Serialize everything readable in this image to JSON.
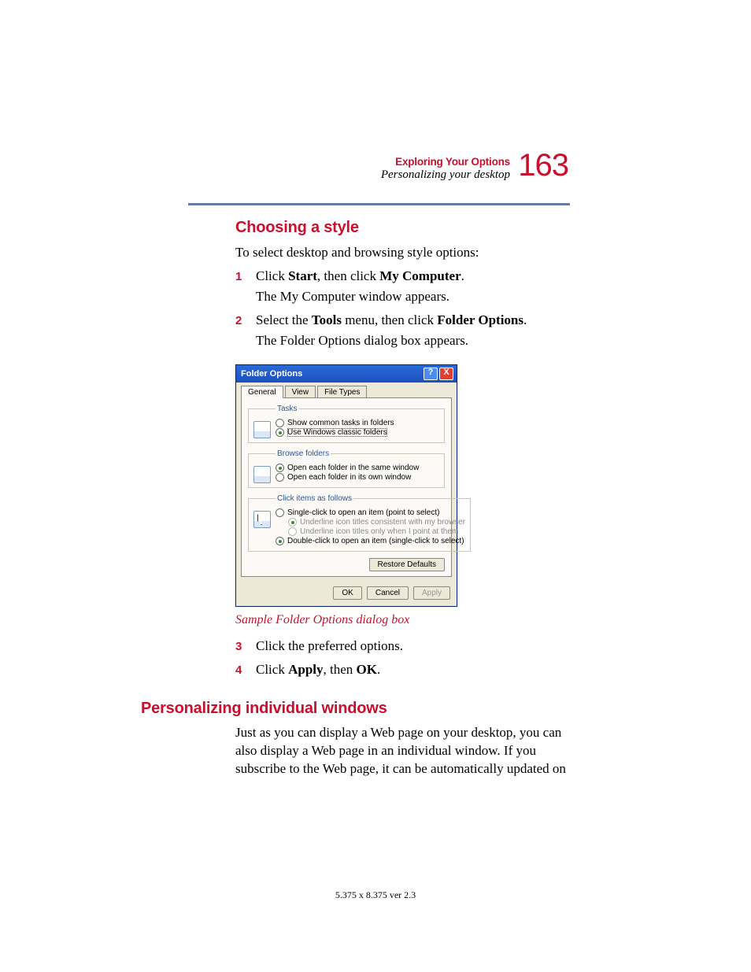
{
  "header": {
    "chapter": "Exploring Your Options",
    "section": "Personalizing your desktop",
    "page_number": "163"
  },
  "section1": {
    "heading": "Choosing a style",
    "intro": "To select desktop and browsing style options:"
  },
  "steps": {
    "s1": {
      "num": "1",
      "p1_a": "Click ",
      "p1_b": "Start",
      "p1_c": ", then click ",
      "p1_d": "My Computer",
      "p1_e": ".",
      "p2": "The My Computer window appears."
    },
    "s2": {
      "num": "2",
      "p1_a": "Select the ",
      "p1_b": "Tools",
      "p1_c": " menu, then click ",
      "p1_d": "Folder Options",
      "p1_e": ".",
      "p2": "The Folder Options dialog box appears."
    },
    "s3": {
      "num": "3",
      "text": "Click the preferred options."
    },
    "s4": {
      "num": "4",
      "p_a": "Click ",
      "p_b": "Apply",
      "p_c": ", then ",
      "p_d": "OK",
      "p_e": "."
    }
  },
  "dialog": {
    "title": "Folder Options",
    "tabs": {
      "general": "General",
      "view": "View",
      "filetypes": "File Types"
    },
    "tasks": {
      "legend": "Tasks",
      "opt1": "Show common tasks in folders",
      "opt2": "Use Windows classic folders"
    },
    "browse": {
      "legend": "Browse folders",
      "opt1": "Open each folder in the same window",
      "opt2": "Open each folder in its own window"
    },
    "click": {
      "legend": "Click items as follows",
      "opt1": "Single-click to open an item (point to select)",
      "sub1": "Underline icon titles consistent with my browser",
      "sub2": "Underline icon titles only when I point at them",
      "opt2": "Double-click to open an item (single-click to select)"
    },
    "restore": "Restore Defaults",
    "ok": "OK",
    "cancel": "Cancel",
    "apply": "Apply"
  },
  "caption": "Sample Folder Options dialog box",
  "section2": {
    "heading": "Personalizing individual windows",
    "body": "Just as you can display a Web page on your desktop, you can also display a Web page in an individual window. If you subscribe to the Web page, it can be automatically updated on"
  },
  "footer": "5.375 x 8.375 ver 2.3"
}
